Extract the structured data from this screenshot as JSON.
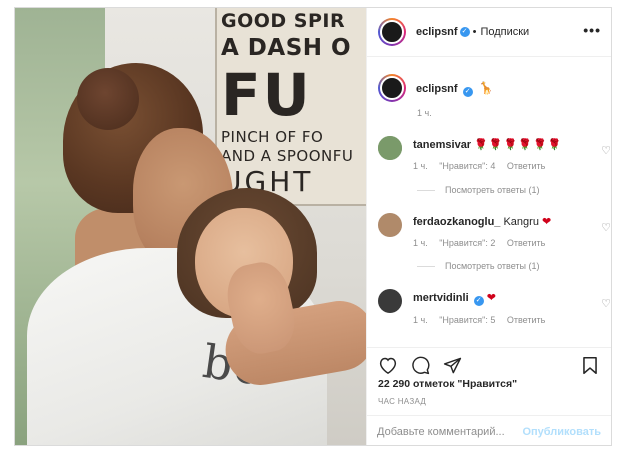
{
  "post": {
    "author": {
      "username": "eclipsnf",
      "verified": true,
      "follow_label": "Подписки",
      "separator": "•",
      "more_glyph": "•••"
    },
    "photo": {
      "sign_lines": [
        "GOOD SPIR",
        "A DASH O",
        "FU",
        "PINCH OF FO",
        "AND A SPOONFU",
        "UGHT"
      ],
      "shirt_text": "bo"
    },
    "caption": {
      "username": "eclipsnf",
      "emoji": "🦒",
      "time": "1 ч."
    },
    "comments": [
      {
        "username": "tanemsivar",
        "text": "🌹🌹🌹🌹🌹🌹",
        "time": "1 ч.",
        "likes": "\"Нравится\": 4",
        "reply": "Ответить",
        "view_replies": "Посмотреть ответы (1)",
        "avatar_color": "#7a9a6a"
      },
      {
        "username": "ferdaozkanoglu_",
        "text": "Kangru",
        "emoji": "❤",
        "time": "1 ч.",
        "likes": "\"Нравится\": 2",
        "reply": "Ответить",
        "view_replies": "Посмотреть ответы (1)",
        "avatar_color": "#b08a6a"
      },
      {
        "username": "mertvidinli",
        "verified": true,
        "emoji": "❤",
        "time": "1 ч.",
        "likes": "\"Нравится\": 5",
        "reply": "Ответить",
        "avatar_color": "#3a3a3a"
      }
    ],
    "actions": {
      "like_icon": "heart-outline-icon",
      "comment_icon": "comment-bubble-icon",
      "share_icon": "paper-plane-icon",
      "save_icon": "bookmark-icon"
    },
    "likes_text": "22 290 отметок \"Нравится\"",
    "time_ago": "ЧАС НАЗАД",
    "comment_box": {
      "placeholder": "Добавьте комментарий...",
      "publish_label": "Опубликовать"
    }
  },
  "colors": {
    "verified": "#3897f0",
    "muted": "#8e8e8e",
    "border": "#dbdbdb",
    "publish_disabled": "#b2dffc",
    "heart_red": "#d0021b"
  }
}
